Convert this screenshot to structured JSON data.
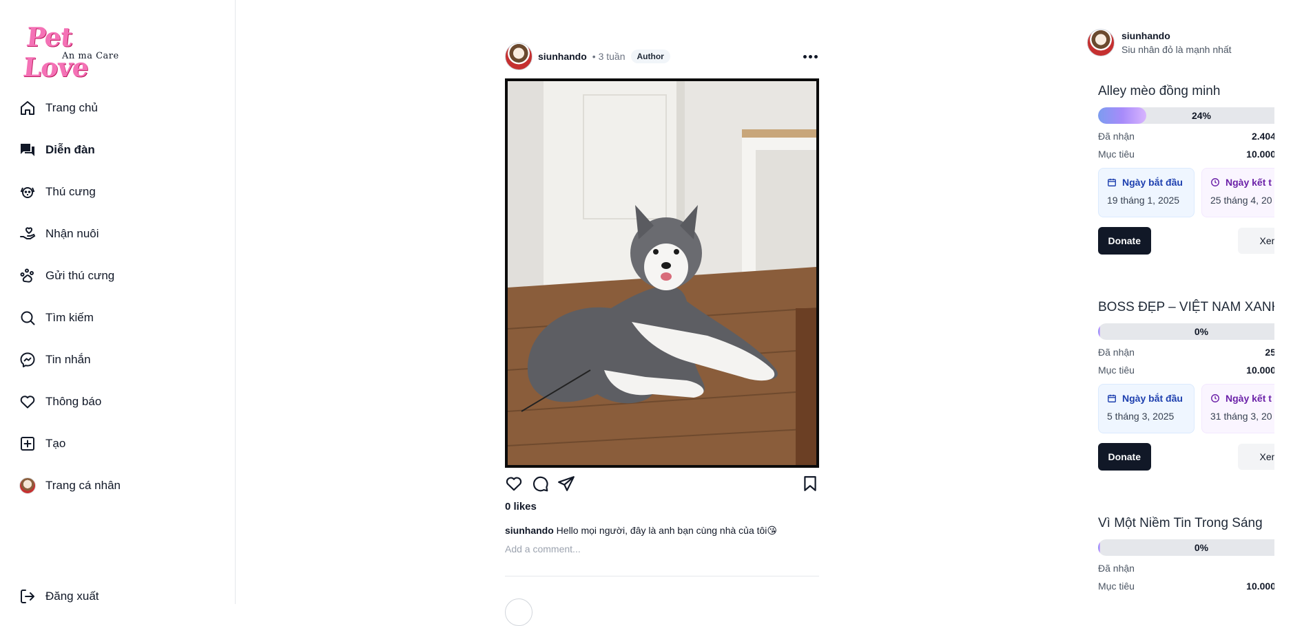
{
  "logo": {
    "title": "Pet Love",
    "subtitle": "An ma Care"
  },
  "sidebar": {
    "items": [
      {
        "label": "Trang chủ",
        "icon": "home-icon"
      },
      {
        "label": "Diễn đàn",
        "icon": "forum-icon",
        "active": true
      },
      {
        "label": "Thú cưng",
        "icon": "pet-face-icon"
      },
      {
        "label": "Nhận nuôi",
        "icon": "adopt-hand-icon"
      },
      {
        "label": "Gửi thú cưng",
        "icon": "paw-icon"
      },
      {
        "label": "Tìm kiếm",
        "icon": "search-icon"
      },
      {
        "label": "Tin nhắn",
        "icon": "messenger-icon"
      },
      {
        "label": "Thông báo",
        "icon": "heart-icon"
      },
      {
        "label": "Tạo",
        "icon": "plus-square-icon"
      },
      {
        "label": "Trang cá nhân",
        "icon": "avatar"
      }
    ],
    "logout": {
      "label": "Đăng xuất",
      "icon": "logout-icon"
    }
  },
  "post": {
    "username": "siunhando",
    "time": "• 3 tuần",
    "badge": "Author",
    "likes": "0 likes",
    "caption_user": "siunhando",
    "caption_text": "Hello mọi người, đây là anh bạn cùng nhà của tôi😘",
    "comment_placeholder": "Add a comment..."
  },
  "profile": {
    "name": "siunhando",
    "bio": "Siu nhân đỏ là mạnh nhất"
  },
  "campaigns": [
    {
      "title": "Alley mèo đồng minh",
      "progress_pct": 24,
      "progress_label": "24%",
      "received_label": "Đã nhận",
      "received_value": "2.404",
      "goal_label": "Mục tiêu",
      "goal_value": "10.000",
      "start_label": "Ngày bắt đầu",
      "start_date": "19 tháng 1, 2025",
      "end_label": "Ngày kết t",
      "end_date": "25 tháng 4, 20",
      "donate_label": "Donate",
      "view_label": "Xem"
    },
    {
      "title": "BOSS ĐẸP – VIỆT NAM XANH",
      "progress_pct": 0,
      "progress_label": "0%",
      "received_label": "Đã nhận",
      "received_value": "25",
      "goal_label": "Mục tiêu",
      "goal_value": "10.000",
      "start_label": "Ngày bắt đầu",
      "start_date": "5 tháng 3, 2025",
      "end_label": "Ngày kết t",
      "end_date": "31 tháng 3, 20",
      "donate_label": "Donate",
      "view_label": "Xem"
    },
    {
      "title": "Vì Một Niềm Tin Trong Sáng",
      "progress_pct": 0,
      "progress_label": "0%",
      "received_label": "Đã nhận",
      "received_value": "",
      "goal_label": "Mục tiêu",
      "goal_value": "10.000"
    }
  ]
}
